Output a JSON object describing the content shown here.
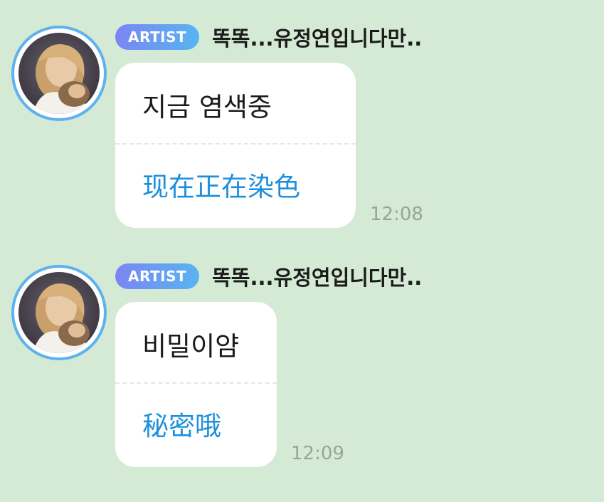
{
  "colors": {
    "background": "#d4ead4",
    "bubble": "#ffffff",
    "translation_text": "#1d8fdc",
    "badge_gradient_start": "#7a86f3",
    "badge_gradient_end": "#58b4f2",
    "avatar_ring": "#5fb1ef",
    "timestamp": "#9aa39a"
  },
  "messages": [
    {
      "badge": "ARTIST",
      "sender": "똑똑...유정연입니다만..",
      "text": "지금 염색중",
      "translation": "现在正在染色",
      "time": "12:08",
      "avatar_icon": "profile-photo"
    },
    {
      "badge": "ARTIST",
      "sender": "똑똑...유정연입니다만..",
      "text": "비밀이얌",
      "translation": "秘密哦",
      "time": "12:09",
      "avatar_icon": "profile-photo"
    }
  ]
}
